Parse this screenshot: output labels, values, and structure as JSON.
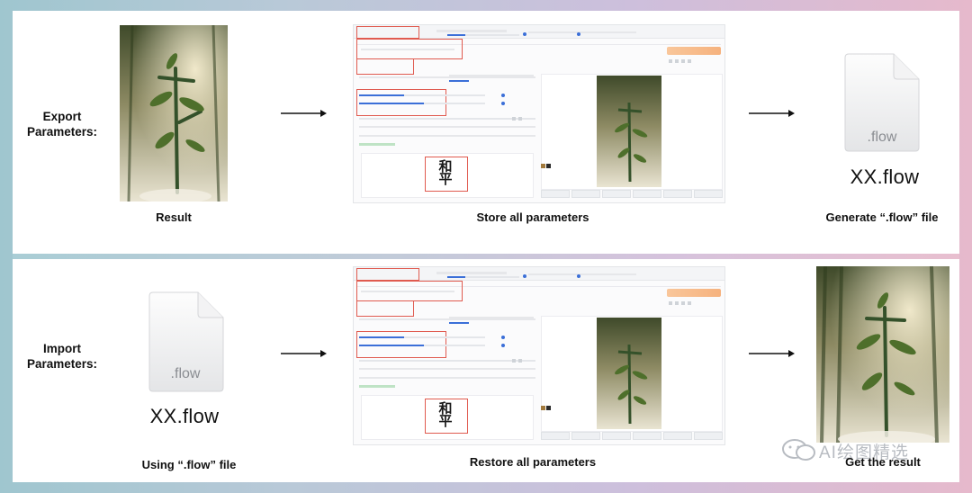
{
  "top_row": {
    "label": "Export Parameters:",
    "result_caption": "Result",
    "store_caption": "Store all parameters",
    "file_name": "XX.flow",
    "file_ext": ".flow",
    "generate_caption": "Generate “.flow” file"
  },
  "bottom_row": {
    "label": "Import Parameters:",
    "file_ext": ".flow",
    "file_name": "XX.flow",
    "using_caption": "Using “.flow” file",
    "restore_caption": "Restore all parameters",
    "get_result_caption": "Get the result"
  },
  "watermark": {
    "text": "AI绘图精选"
  },
  "screenshot": {
    "calligraphy": "和平"
  },
  "colors": {
    "highlight_box": "#e05a4f",
    "slider": "#3b6fd8",
    "generate_button": "#f6b27e"
  }
}
